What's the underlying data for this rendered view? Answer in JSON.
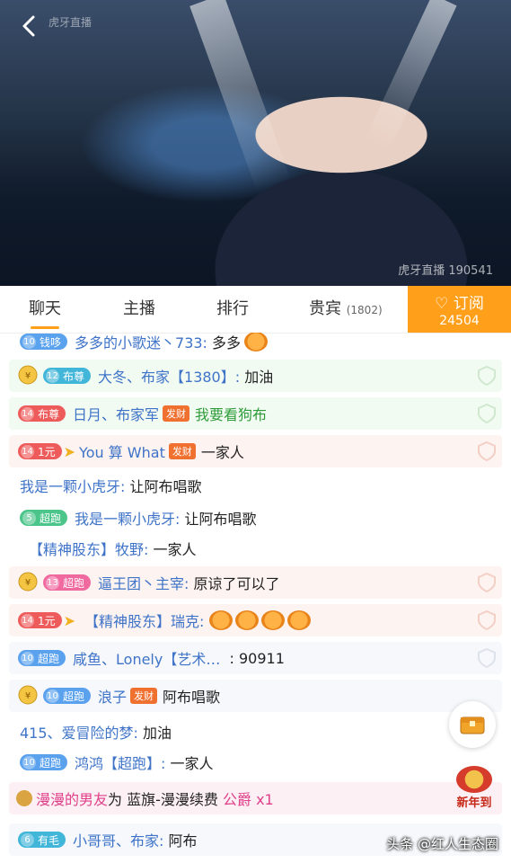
{
  "video": {
    "watermark": "虎牙直播 190541",
    "brand": "虎牙直播"
  },
  "tabs": [
    {
      "label": "聊天"
    },
    {
      "label": "主播"
    },
    {
      "label": "排行"
    },
    {
      "label": "贵宾",
      "count": "(1802)"
    }
  ],
  "subscribe": {
    "label": "订阅",
    "count": "24504"
  },
  "chat": {
    "r1": {
      "level": "10",
      "badge": "钱哆",
      "nick": "多多的小歌迷丶733:",
      "msg": "多多"
    },
    "r2": {
      "level": "12",
      "badge": "布尊",
      "nick": "大冬、布家【1380】:",
      "msg": "加油"
    },
    "r3": {
      "level": "14",
      "badge": "布尊",
      "nick": "日月、布家军",
      "tag": "发财",
      "msg": "我要看狗布"
    },
    "r4": {
      "level": "14",
      "badge": "1元",
      "nick": "You 算 What",
      "tag": "发财",
      "msg": "一家人"
    },
    "r5": {
      "nick": "我是一颗小虎牙:",
      "msg": "让阿布唱歌"
    },
    "r6": {
      "level": "5",
      "badge": "超跑",
      "nick": "我是一颗小虎牙:",
      "msg": "让阿布唱歌"
    },
    "r7": {
      "nick": "【精神股东】牧野:",
      "msg": "一家人"
    },
    "r8": {
      "level": "13",
      "badge": "超跑",
      "nick": "逼王团丶主宰:",
      "msg": "原谅了可以了"
    },
    "r9": {
      "level": "14",
      "badge": "1元",
      "nick": "【精神股东】瑞克:"
    },
    "r10": {
      "level": "10",
      "badge": "超跑",
      "nick": "咸鱼、Lonely【艺术…",
      "msg": ":  90911"
    },
    "r11": {
      "level": "10",
      "badge": "超跑",
      "nick": "浪子",
      "tag": "发财",
      "msg": "阿布唱歌"
    },
    "r12": {
      "nick": "415、爱冒险的梦:",
      "msg": "加油"
    },
    "r13": {
      "level": "10",
      "badge": "超跑",
      "nick": "鸿鸿【超跑】:",
      "msg": "一家人"
    },
    "r14": {
      "nick": "漫漫的男友",
      "mid": "为",
      "target": "蓝旗-漫漫续费",
      "noble": "公爵 x1"
    },
    "r15": {
      "level": "6",
      "badge": "有毛",
      "nick": "小哥哥、布家:",
      "msg": "阿布"
    }
  },
  "floating": {
    "new_year": "新年到"
  },
  "footer": {
    "watermark": "头条 @红人生态圈"
  },
  "colors": {
    "accent": "#ff9f1a",
    "nick": "#3e73c8"
  }
}
